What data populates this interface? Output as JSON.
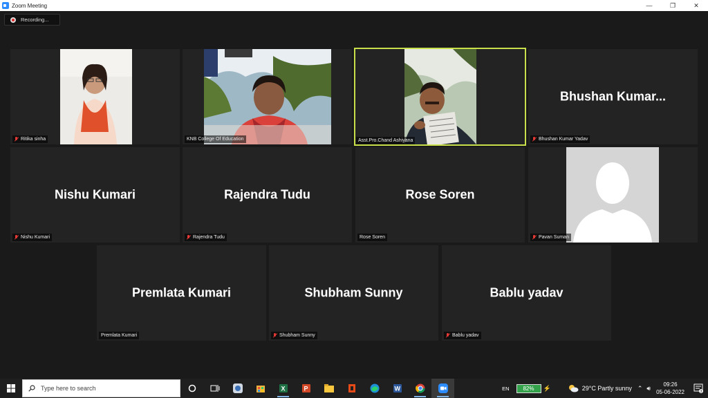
{
  "window": {
    "title": "Zoom Meeting"
  },
  "recording": {
    "label": "Recording..."
  },
  "participants": [
    {
      "label": "Ritika sinha",
      "big": ""
    },
    {
      "label": "KNB College Of Education",
      "big": ""
    },
    {
      "label": "Asst.Pro.Chand Ashiyana",
      "big": ""
    },
    {
      "label": "Bhushan Kumar Yadav",
      "big": "Bhushan  Kumar..."
    },
    {
      "label": "Nishu Kumari",
      "big": "Nishu Kumari"
    },
    {
      "label": "Rajendra Tudu",
      "big": "Rajendra Tudu"
    },
    {
      "label": "Rose Soren",
      "big": "Rose Soren"
    },
    {
      "label": "Pavan Suman",
      "big": ""
    },
    {
      "label": "Premlata Kumari",
      "big": "Premlata Kumari"
    },
    {
      "label": "Shubham Sunny",
      "big": "Shubham Sunny"
    },
    {
      "label": "Bablu yadav",
      "big": "Bablu yadav"
    }
  ],
  "taskbar": {
    "search_placeholder": "Type here to search",
    "icons": [
      "start-icon",
      "cortana-icon",
      "task-view-icon",
      "app-icon",
      "store-icon",
      "excel-icon",
      "powerpoint-icon",
      "file-explorer-icon",
      "office-icon",
      "edge-icon",
      "word-icon",
      "chrome-icon",
      "zoom-icon"
    ]
  },
  "tray": {
    "language": "EN",
    "battery": "82%",
    "weather": "29°C  Partly sunny",
    "time": "09:26",
    "date": "05-06-2022",
    "notifications": "3"
  },
  "colors": {
    "active_speaker": "#c9e04a",
    "mic_muted": "#e53935",
    "tile_bg": "#232323"
  }
}
